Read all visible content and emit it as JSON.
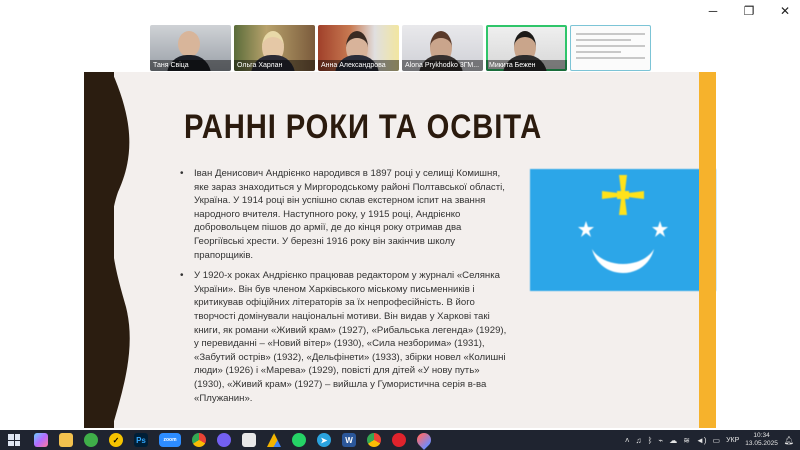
{
  "window": {
    "controls": [
      "minimize-icon",
      "restore-icon",
      "close-icon"
    ]
  },
  "participants": [
    {
      "name": "Таня Свіца"
    },
    {
      "name": "Ольга Харлан"
    },
    {
      "name": "Анна Александрова"
    },
    {
      "name": "Alona Prykhodko 3ГМ..."
    },
    {
      "name": "Микита Бежен"
    },
    {
      "name": ""
    }
  ],
  "slide": {
    "title": "РАННІ РОКИ ТА ОСВІТА",
    "bullets": [
      "Іван Денисович Андрієнко народився в 1897 році у селищі Комишня, яке зараз знаходиться у Миргородському районі Полтавської області, Україна. У 1914 році він успішно склав екстерном іспит на звання народного вчителя. Наступного року, у 1915 році, Андрієнко добровольцем пішов до армії, де до кінця року отримав два Георгіївські хрести. У березні 1916 року він закінчив школу прапорщиків.",
      "У 1920-х роках Андрієнко працював редактором у журналі «Селянка України». Він був членом Харківського міському письменників і критикував офіційних літераторів за їх непрофесійність. В його творчості домінували національні мотиви. Він видав у Харкові такі книги, як романи «Живий крам» (1927), «Рибальська легенда» (1929), у перевиданні – «Новий вітер» (1930), «Сила незборима» (1931), «Забутий острів» (1932), «Дельфінети» (1933), збірки новел «Колишні люди» (1926) і «Марева» (1929), повісті для дітей «У нову путь» (1930), «Живий крам» (1927) – вийшла у Гумористична серія в-ва «Плужанин»."
    ],
    "colors": {
      "dark": "#2b1d10",
      "accent": "#f6b22c",
      "background": "#f3efed",
      "flag_blue": "#2ca6e8",
      "flag_yellow": "#ffe21a"
    }
  },
  "taskbar": {
    "apps": [
      "start-icon",
      "copilot-icon",
      "file-explorer-icon",
      "green-app-icon",
      "norton-icon",
      "photoshop-icon",
      "zoom-icon",
      "chrome-icon",
      "viber-icon",
      "files-icon",
      "google-drive-icon",
      "whatsapp-icon",
      "telegram-icon",
      "word-icon",
      "chrome-alt-icon",
      "recorder-icon",
      "droplet-icon"
    ],
    "photoshop_label": "Ps",
    "zoom_label": "zoom",
    "language": "УКР",
    "time": "10:34",
    "date": "13.05.2025"
  }
}
